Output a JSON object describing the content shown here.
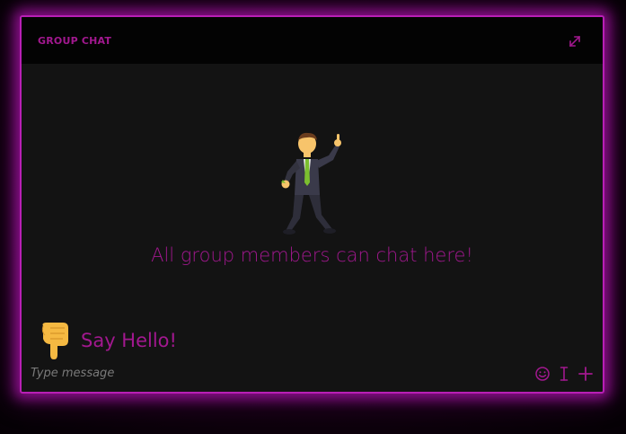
{
  "chat": {
    "title": "GROUP CHAT",
    "empty_message": "All group members can chat here!",
    "hint": "Say Hello!"
  },
  "composer": {
    "placeholder": "Type message"
  },
  "icons": {
    "expand": "expand-icon",
    "emoji": "smiley-icon",
    "format": "text-cursor-icon",
    "attach": "plus-icon",
    "illustration": "dancing-man-icon",
    "pointer": "pointing-down-hand-icon"
  },
  "colors": {
    "accent": "#a2188f",
    "border": "#b81fb5",
    "background": "#131313",
    "header": "#030303"
  }
}
